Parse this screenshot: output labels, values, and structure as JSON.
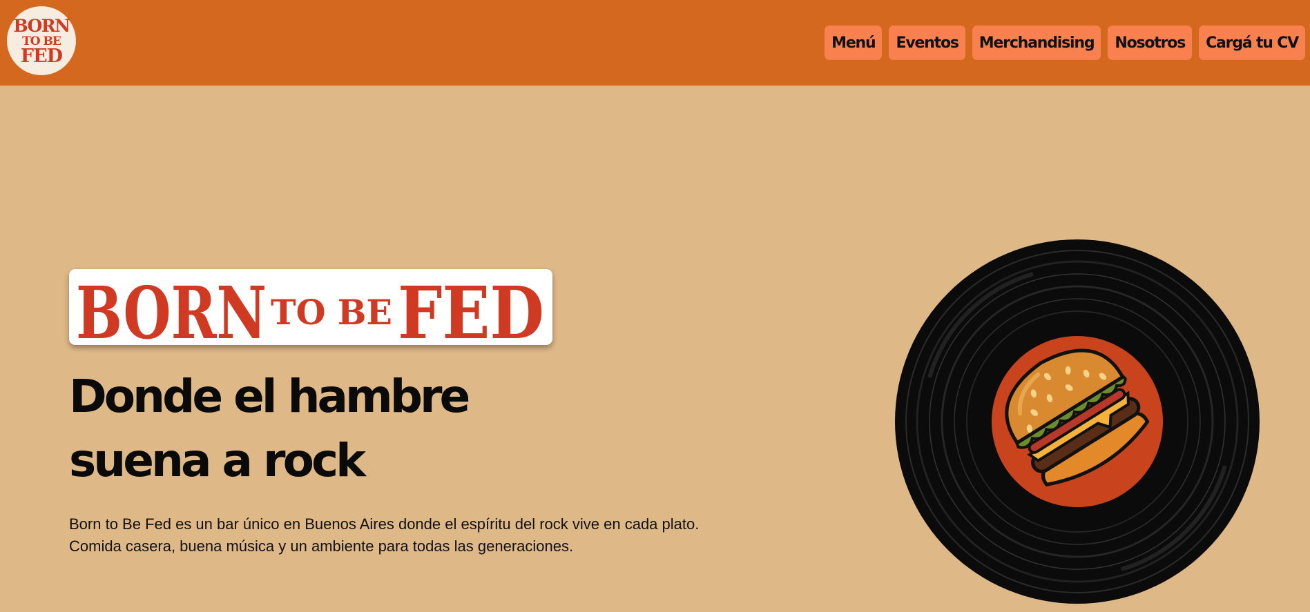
{
  "header": {
    "logo": {
      "line1": "BORN",
      "line2": "TO BE",
      "line3": "FED",
      "icon": "born-to-be-fed-logo"
    },
    "nav": [
      {
        "label": "Menú"
      },
      {
        "label": "Eventos"
      },
      {
        "label": "Merchandising"
      },
      {
        "label": "Nosotros"
      },
      {
        "label": "Cargá tu CV"
      }
    ]
  },
  "hero": {
    "brand": {
      "born": "BORN",
      "tobe": "TO BE",
      "fed": "FED"
    },
    "headline": [
      "Donde el hambre",
      "suena a rock"
    ],
    "description": [
      "Born to Be Fed es un bar único en Buenos Aires donde el espíritu del rock vive en cada plato.",
      "Comida casera, buena música y un ambiente para todas las generaciones."
    ],
    "image": {
      "icon": "vinyl-record-burger-illustration"
    }
  },
  "colors": {
    "header_bg": "#d4681f",
    "page_bg": "#deb887",
    "nav_button_bg": "#f9814f",
    "brand_red": "#d13a22",
    "logo_circle_bg": "#f6ece0"
  }
}
